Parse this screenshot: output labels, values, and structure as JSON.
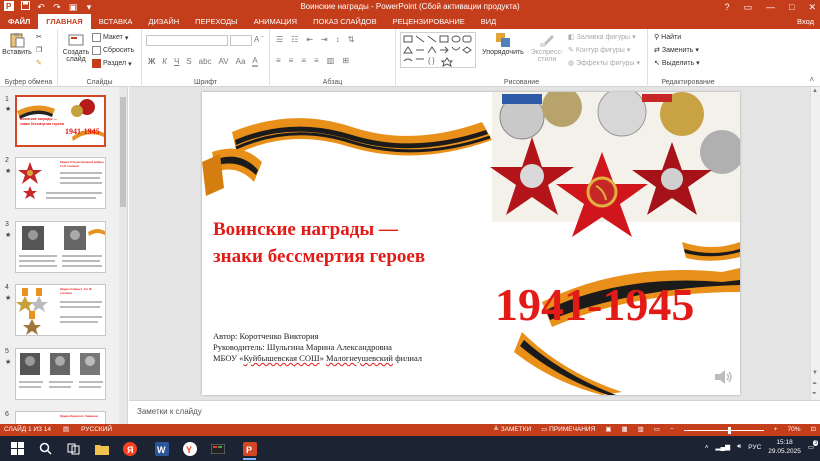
{
  "window": {
    "title": "Воинские награды  -  PowerPoint (Сбой активации продукта)",
    "signin": "Вход",
    "controls": [
      "?",
      "▭",
      "—",
      "□",
      "✕"
    ]
  },
  "tabs": [
    "ФАЙЛ",
    "ГЛАВНАЯ",
    "ВСТАВКА",
    "ДИЗАЙН",
    "ПЕРЕХОДЫ",
    "АНИМАЦИЯ",
    "ПОКАЗ СЛАЙДОВ",
    "РЕЦЕНЗИРОВАНИЕ",
    "ВИД"
  ],
  "ribbon": {
    "clipboard": {
      "paste": "Вставить",
      "label": "Буфер обмена"
    },
    "slides": {
      "create": "Создать слайд",
      "layout": "Макет",
      "reset": "Сбросить",
      "section": "Раздел",
      "label": "Слайды"
    },
    "font": {
      "bold": "Ж",
      "italic": "К",
      "underline": "Ч",
      "strike": "S",
      "shadow": "abc",
      "spacing": "AV",
      "case": "Aa",
      "label": "Шрифт"
    },
    "paragraph": {
      "label": "Абзац"
    },
    "drawing": {
      "arrange": "Упорядочить",
      "quick_styles": "Экспресс-стили",
      "fill": "Заливка фигуры",
      "outline": "Контур фигуры",
      "effects": "Эффекты фигуры",
      "label": "Рисование"
    },
    "editing": {
      "find": "Найти",
      "replace": "Заменить",
      "select": "Выделить",
      "label": "Редактирование"
    }
  },
  "thumbnails": [
    {
      "num": "1",
      "title": "Воинские награды — знаки бессмертия героев",
      "years": "1941-1945"
    },
    {
      "num": "2",
      "title": "Орден Отечественной войны I и II степени"
    },
    {
      "num": "3"
    },
    {
      "num": "4",
      "title": "Орден Славы I, II и III степени"
    },
    {
      "num": "5"
    },
    {
      "num": "6",
      "title": "Орден Красного Знамени"
    }
  ],
  "slide": {
    "title_line1": "Воинские награды —",
    "title_line2": "знаки бессмертия героев",
    "years": "1941-1945",
    "author": "Автор: Коротченко Виктория",
    "supervisor": "Руководитель: Шульгина Марина Александровна",
    "school_prefix": "МБОУ «",
    "school_name": "Куйбышевская СОШ",
    "school_mid": "» ",
    "school_branch": "Малогнеушевский",
    "school_suffix": " филиал"
  },
  "notes_placeholder": "Заметки к слайду",
  "status": {
    "slide_info": "СЛАЙД 1 ИЗ 14",
    "language": "РУССКИЙ",
    "notes": "ЗАМЕТКИ",
    "comments": "ПРИМЕЧАНИЯ",
    "zoom": "70%"
  },
  "taskbar": {
    "lang": "РУС",
    "time": "15:18",
    "date": "29.05.2025",
    "notify": "3"
  },
  "colors": {
    "accent": "#c43e1c",
    "title_red": "#e31b17",
    "taskbar": "#1c2433"
  }
}
